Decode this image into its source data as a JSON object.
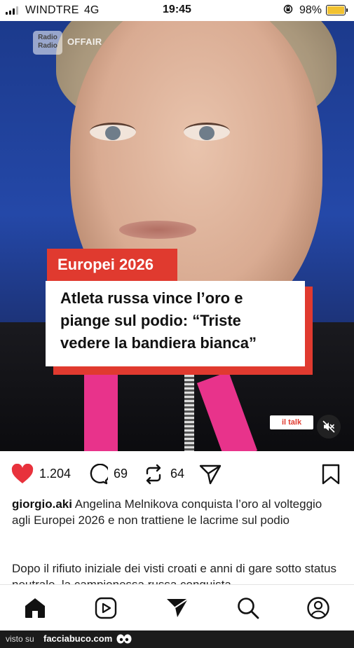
{
  "status_bar": {
    "carrier": "WINDTRE",
    "network": "4G",
    "time": "19:45",
    "battery": "98%",
    "battery_color": "#f2c230"
  },
  "video": {
    "channel_logo": "Radio Radio",
    "channel_tag": "OFFAIR",
    "badge": "Europei 2026",
    "headline_line1": "Atleta russa vince l’oro e",
    "headline_line2": "piange sul podio: “Triste",
    "headline_line3": "vedere la bandiera bianca”",
    "watermark": "il talk",
    "accent_color": "#e03a2f",
    "mute_icon": "speaker-muted-icon"
  },
  "actions": {
    "likes": "1.204",
    "comments": "69",
    "reposts": "64",
    "icons": [
      "heart-icon",
      "comment-icon",
      "repost-icon",
      "share-icon",
      "bookmark-icon"
    ],
    "like_color": "#e8323c"
  },
  "post": {
    "username": "giorgio.aki",
    "caption": "Angelina Melnikova conquista l’oro al volteggio agli Europei 2026 e non trattiene le lacrime sul podio",
    "more_text": "Dopo il rifiuto iniziale dei visti croati e anni di gare sotto status neutrale, la campionessa russa conquista"
  },
  "nav": {
    "items": [
      "home-icon",
      "reels-icon",
      "send-icon",
      "search-icon",
      "profile-icon"
    ]
  },
  "footer": {
    "prefix": "visto su",
    "site": "facciabuco.com"
  }
}
